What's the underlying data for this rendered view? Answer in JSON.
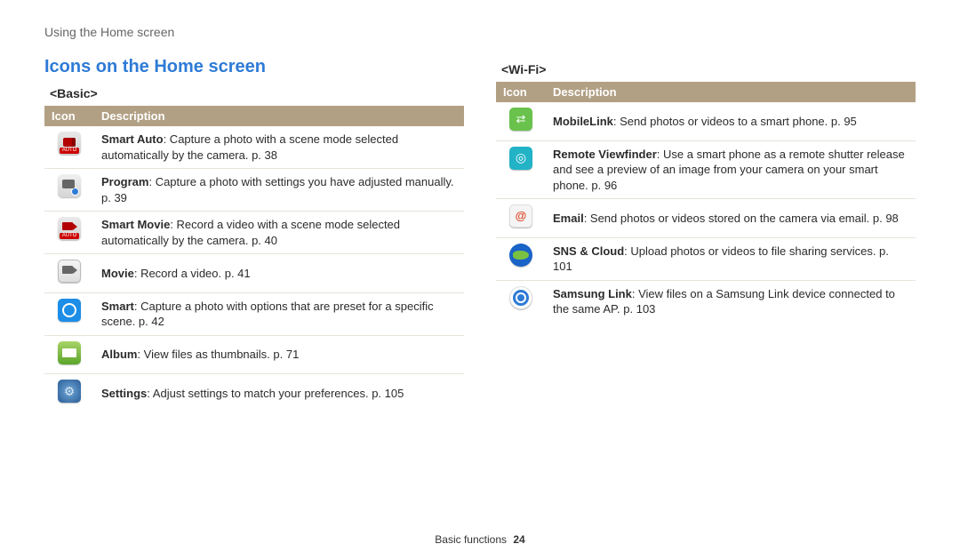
{
  "breadcrumb": "Using the Home screen",
  "section_title": "Icons on the Home screen",
  "headers": {
    "icon": "Icon",
    "description": "Description"
  },
  "basic": {
    "heading": "<Basic>",
    "rows": [
      {
        "bold": "Smart Auto",
        "rest": ": Capture a photo with a scene mode selected automatically by the camera. p. 38"
      },
      {
        "bold": "Program",
        "rest": ": Capture a photo with settings you have adjusted manually. p. 39"
      },
      {
        "bold": "Smart Movie",
        "rest": ": Record a video with a scene mode selected automatically by the camera. p. 40"
      },
      {
        "bold": "Movie",
        "rest": ": Record a video. p. 41"
      },
      {
        "bold": "Smart",
        "rest": ": Capture a photo with options that are preset for a specific scene. p. 42"
      },
      {
        "bold": "Album",
        "rest": ": View files as thumbnails. p. 71"
      },
      {
        "bold": "Settings",
        "rest": ": Adjust settings to match your preferences. p. 105"
      }
    ]
  },
  "wifi": {
    "heading": "<Wi-Fi>",
    "rows": [
      {
        "bold": "MobileLink",
        "rest": ": Send photos or videos to a smart phone. p. 95"
      },
      {
        "bold": "Remote Viewfinder",
        "rest": ": Use a smart phone as a remote shutter release and see a preview of an image from your camera on your smart phone. p. 96"
      },
      {
        "bold": "Email",
        "rest": ": Send photos or videos stored on the camera via email. p. 98"
      },
      {
        "bold": "SNS & Cloud",
        "rest": ": Upload photos or videos to file sharing services. p. 101"
      },
      {
        "bold": "Samsung Link",
        "rest": ": View files on a Samsung Link device connected to the same AP. p. 103"
      }
    ]
  },
  "footer": {
    "section": "Basic functions",
    "page": "24"
  }
}
